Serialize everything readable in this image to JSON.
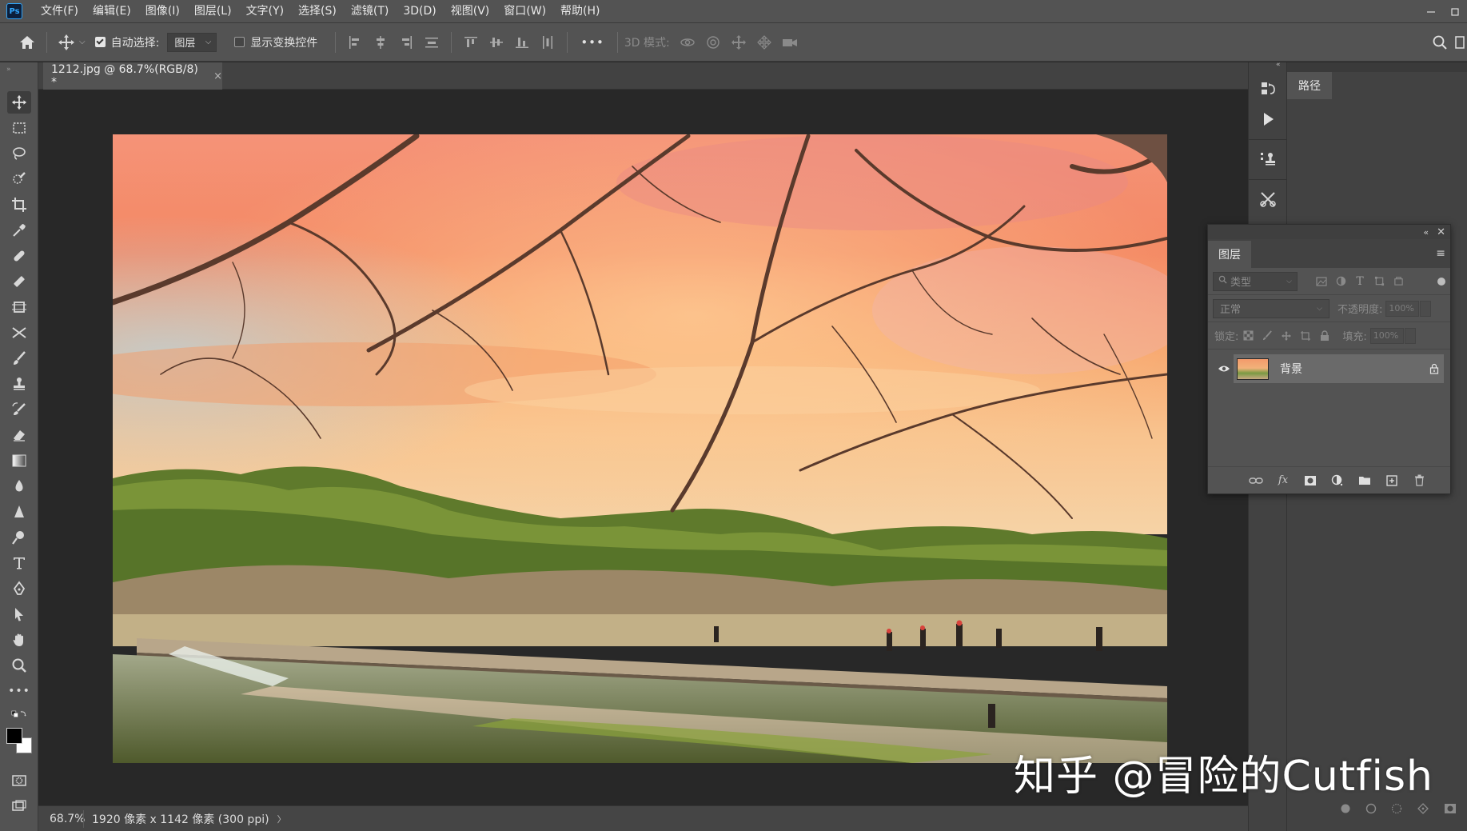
{
  "app": {
    "logo": "Ps",
    "menu": [
      "文件(F)",
      "编辑(E)",
      "图像(I)",
      "图层(L)",
      "文字(Y)",
      "选择(S)",
      "滤镜(T)",
      "3D(D)",
      "视图(V)",
      "窗口(W)",
      "帮助(H)"
    ]
  },
  "options": {
    "auto_select_label": "自动选择:",
    "auto_select_checked": true,
    "auto_select_target": "图层",
    "show_transform_label": "显示变换控件",
    "show_transform_checked": false,
    "more": "•••",
    "mode_3d_label": "3D 模式:"
  },
  "document": {
    "tab_title": "1212.jpg @ 68.7%(RGB/8) *",
    "tab_close": "×"
  },
  "status": {
    "zoom": "68.7%",
    "info": "1920 像素 x 1142 像素 (300 ppi)",
    "arrow": "〉"
  },
  "paths_panel": {
    "tab": "路径"
  },
  "layers_panel": {
    "tab": "图层",
    "filter_placeholder": "类型",
    "blend_mode": "正常",
    "opacity_label": "不透明度:",
    "opacity_value": "100%",
    "lock_label": "锁定:",
    "fill_label": "填充:",
    "fill_value": "100%",
    "layers": [
      {
        "name": "背景",
        "visible": true,
        "locked": true
      }
    ]
  },
  "watermark": "知乎 @冒险的Cutfish",
  "colors": {
    "accent": "#31a8ff",
    "panel": "#535353",
    "panel_dark": "#424242",
    "canvas_bg": "#282828"
  }
}
